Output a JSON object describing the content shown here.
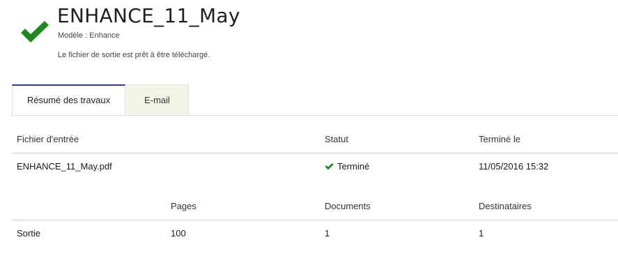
{
  "job": {
    "title": "ENHANCE_11_May",
    "model_label": "Modèle : Enhance",
    "ready_message": "Le fichier de sortie est prêt à être téléchargé.",
    "status_icon": "checkmark-icon"
  },
  "tabs": [
    {
      "label": "Résumé des travaux",
      "active": true
    },
    {
      "label": "E-mail",
      "active": false
    }
  ],
  "input_table": {
    "headers": [
      "Fichier d'entrée",
      "Statut",
      "Terminé le"
    ],
    "rows": [
      {
        "file": "ENHANCE_11_May.pdf",
        "status": "Terminé",
        "status_icon": "checkmark-icon",
        "completed": "11/05/2016 15:32"
      }
    ]
  },
  "output_table": {
    "headers": [
      "",
      "Pages",
      "Documents",
      "Destinataires"
    ],
    "rows": [
      {
        "label": "Sortie",
        "pages": "100",
        "documents": "1",
        "recipients": "1"
      }
    ]
  },
  "colors": {
    "check_green": "#1e8a1e",
    "tab_active_border": "#2b3a8f",
    "tab_inactive_bg": "#f3f3e6"
  }
}
